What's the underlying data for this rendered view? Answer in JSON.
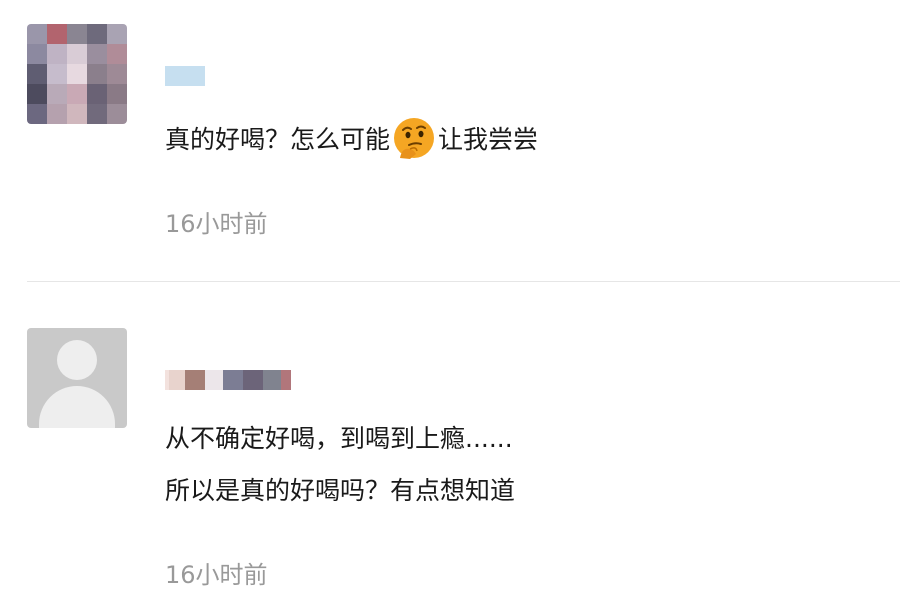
{
  "comments": [
    {
      "text_parts": [
        "真的好喝？怎么可能",
        "让我尝尝"
      ],
      "emoji": "thinking-face-icon",
      "time": "16小时前",
      "avatar": "pixelated-avatar"
    },
    {
      "lines": [
        "从不确定好喝，到喝到上瘾......",
        "所以是真的好喝吗？有点想知道"
      ],
      "time": "16小时前",
      "avatar": "default-avatar-icon"
    }
  ],
  "colors": {
    "text": "#1a1a1a",
    "time": "#999999",
    "divider": "#e6e6e6",
    "emoji": "#f5a623"
  }
}
